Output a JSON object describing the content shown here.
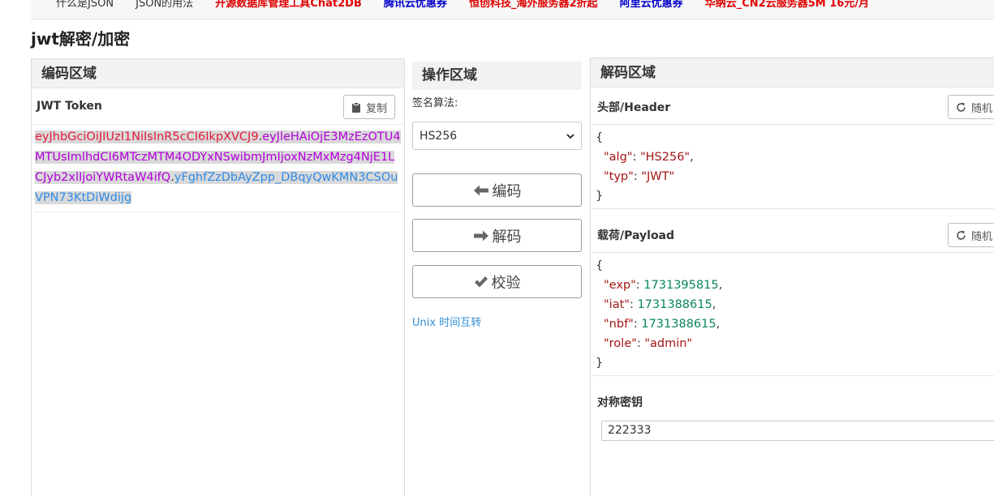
{
  "nav": {
    "items": [
      {
        "label": "什么是JSON",
        "style": "plain"
      },
      {
        "label": "JSON的用法",
        "style": "plain"
      },
      {
        "label": "开源数据库管理工具Chat2DB",
        "style": "red"
      },
      {
        "label": "腾讯云优惠券",
        "style": "blue"
      },
      {
        "label": "恒创科技_海外服务器2折起",
        "style": "red"
      },
      {
        "label": "阿里云优惠券",
        "style": "blue"
      },
      {
        "label": "华纳云_CN2云服务器5M 16元/月",
        "style": "red"
      }
    ]
  },
  "page": {
    "title": "jwt解密/加密"
  },
  "encode_panel": {
    "title": "编码区域",
    "token_label": "JWT Token",
    "copy_label": "复制",
    "token_header": "eyJhbGciOiJIUzI1NiIsInR5cCI6IkpXVCJ9",
    "dot1": ".",
    "token_payload": "eyJleHAiOjE3MzEzOTU4MTUsImlhdCI6MTczMTM4ODYxNSwibmJmIjoxNzMxMzg4NjE1LCJyb2xlIjoiYWRtaW4ifQ",
    "dot2": ".",
    "token_signature": "yFghfZzDbAyZpp_DBqyQwKMN3CSOuVPN73KtDiWdijg",
    "colors": {
      "header": "#e31b3c",
      "payload": "#b300d9",
      "signature": "#2f8be6"
    }
  },
  "ops_panel": {
    "title": "操作区域",
    "algo_label": "签名算法:",
    "algo_selected": "HS256",
    "encode_label": "编码",
    "decode_label": "解码",
    "verify_label": "校验",
    "unix_link": "Unix 时间互转"
  },
  "decode_panel": {
    "title": "解码区域",
    "header_label": "头部/Header",
    "payload_label": "载荷/Payload",
    "random_label": "随机",
    "open_brace": "{",
    "close_brace": "}",
    "header_json": [
      {
        "key": "\"alg\"",
        "value": "\"HS256\"",
        "type": "string",
        "comma": ","
      },
      {
        "key": "\"typ\"",
        "value": "\"JWT\"",
        "type": "string",
        "comma": ""
      }
    ],
    "payload_json": [
      {
        "key": "\"exp\"",
        "value": "1731395815",
        "type": "number",
        "comma": ","
      },
      {
        "key": "\"iat\"",
        "value": "1731388615",
        "type": "number",
        "comma": ","
      },
      {
        "key": "\"nbf\"",
        "value": "1731388615",
        "type": "number",
        "comma": ","
      },
      {
        "key": "\"role\"",
        "value": "\"admin\"",
        "type": "string",
        "comma": ""
      }
    ],
    "secret_label": "对称密钥",
    "secret_value": "222333"
  }
}
